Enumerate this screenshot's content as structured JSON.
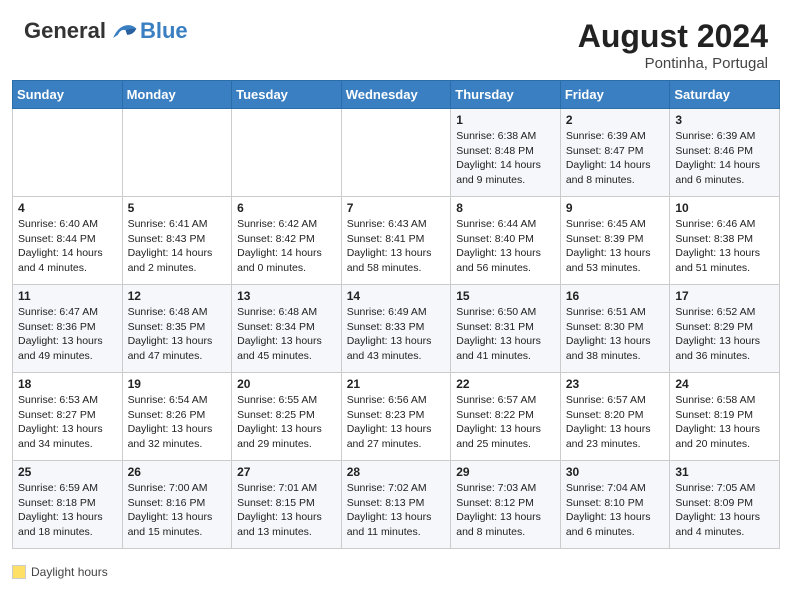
{
  "header": {
    "logo_general": "General",
    "logo_blue": "Blue",
    "month_year": "August 2024",
    "location": "Pontinha, Portugal"
  },
  "days_of_week": [
    "Sunday",
    "Monday",
    "Tuesday",
    "Wednesday",
    "Thursday",
    "Friday",
    "Saturday"
  ],
  "weeks": [
    [
      {
        "day": "",
        "info": ""
      },
      {
        "day": "",
        "info": ""
      },
      {
        "day": "",
        "info": ""
      },
      {
        "day": "",
        "info": ""
      },
      {
        "day": "1",
        "info": "Sunrise: 6:38 AM\nSunset: 8:48 PM\nDaylight: 14 hours\nand 9 minutes."
      },
      {
        "day": "2",
        "info": "Sunrise: 6:39 AM\nSunset: 8:47 PM\nDaylight: 14 hours\nand 8 minutes."
      },
      {
        "day": "3",
        "info": "Sunrise: 6:39 AM\nSunset: 8:46 PM\nDaylight: 14 hours\nand 6 minutes."
      }
    ],
    [
      {
        "day": "4",
        "info": "Sunrise: 6:40 AM\nSunset: 8:44 PM\nDaylight: 14 hours\nand 4 minutes."
      },
      {
        "day": "5",
        "info": "Sunrise: 6:41 AM\nSunset: 8:43 PM\nDaylight: 14 hours\nand 2 minutes."
      },
      {
        "day": "6",
        "info": "Sunrise: 6:42 AM\nSunset: 8:42 PM\nDaylight: 14 hours\nand 0 minutes."
      },
      {
        "day": "7",
        "info": "Sunrise: 6:43 AM\nSunset: 8:41 PM\nDaylight: 13 hours\nand 58 minutes."
      },
      {
        "day": "8",
        "info": "Sunrise: 6:44 AM\nSunset: 8:40 PM\nDaylight: 13 hours\nand 56 minutes."
      },
      {
        "day": "9",
        "info": "Sunrise: 6:45 AM\nSunset: 8:39 PM\nDaylight: 13 hours\nand 53 minutes."
      },
      {
        "day": "10",
        "info": "Sunrise: 6:46 AM\nSunset: 8:38 PM\nDaylight: 13 hours\nand 51 minutes."
      }
    ],
    [
      {
        "day": "11",
        "info": "Sunrise: 6:47 AM\nSunset: 8:36 PM\nDaylight: 13 hours\nand 49 minutes."
      },
      {
        "day": "12",
        "info": "Sunrise: 6:48 AM\nSunset: 8:35 PM\nDaylight: 13 hours\nand 47 minutes."
      },
      {
        "day": "13",
        "info": "Sunrise: 6:48 AM\nSunset: 8:34 PM\nDaylight: 13 hours\nand 45 minutes."
      },
      {
        "day": "14",
        "info": "Sunrise: 6:49 AM\nSunset: 8:33 PM\nDaylight: 13 hours\nand 43 minutes."
      },
      {
        "day": "15",
        "info": "Sunrise: 6:50 AM\nSunset: 8:31 PM\nDaylight: 13 hours\nand 41 minutes."
      },
      {
        "day": "16",
        "info": "Sunrise: 6:51 AM\nSunset: 8:30 PM\nDaylight: 13 hours\nand 38 minutes."
      },
      {
        "day": "17",
        "info": "Sunrise: 6:52 AM\nSunset: 8:29 PM\nDaylight: 13 hours\nand 36 minutes."
      }
    ],
    [
      {
        "day": "18",
        "info": "Sunrise: 6:53 AM\nSunset: 8:27 PM\nDaylight: 13 hours\nand 34 minutes."
      },
      {
        "day": "19",
        "info": "Sunrise: 6:54 AM\nSunset: 8:26 PM\nDaylight: 13 hours\nand 32 minutes."
      },
      {
        "day": "20",
        "info": "Sunrise: 6:55 AM\nSunset: 8:25 PM\nDaylight: 13 hours\nand 29 minutes."
      },
      {
        "day": "21",
        "info": "Sunrise: 6:56 AM\nSunset: 8:23 PM\nDaylight: 13 hours\nand 27 minutes."
      },
      {
        "day": "22",
        "info": "Sunrise: 6:57 AM\nSunset: 8:22 PM\nDaylight: 13 hours\nand 25 minutes."
      },
      {
        "day": "23",
        "info": "Sunrise: 6:57 AM\nSunset: 8:20 PM\nDaylight: 13 hours\nand 23 minutes."
      },
      {
        "day": "24",
        "info": "Sunrise: 6:58 AM\nSunset: 8:19 PM\nDaylight: 13 hours\nand 20 minutes."
      }
    ],
    [
      {
        "day": "25",
        "info": "Sunrise: 6:59 AM\nSunset: 8:18 PM\nDaylight: 13 hours\nand 18 minutes."
      },
      {
        "day": "26",
        "info": "Sunrise: 7:00 AM\nSunset: 8:16 PM\nDaylight: 13 hours\nand 15 minutes."
      },
      {
        "day": "27",
        "info": "Sunrise: 7:01 AM\nSunset: 8:15 PM\nDaylight: 13 hours\nand 13 minutes."
      },
      {
        "day": "28",
        "info": "Sunrise: 7:02 AM\nSunset: 8:13 PM\nDaylight: 13 hours\nand 11 minutes."
      },
      {
        "day": "29",
        "info": "Sunrise: 7:03 AM\nSunset: 8:12 PM\nDaylight: 13 hours\nand 8 minutes."
      },
      {
        "day": "30",
        "info": "Sunrise: 7:04 AM\nSunset: 8:10 PM\nDaylight: 13 hours\nand 6 minutes."
      },
      {
        "day": "31",
        "info": "Sunrise: 7:05 AM\nSunset: 8:09 PM\nDaylight: 13 hours\nand 4 minutes."
      }
    ]
  ],
  "legend": {
    "daylight_label": "Daylight hours"
  }
}
